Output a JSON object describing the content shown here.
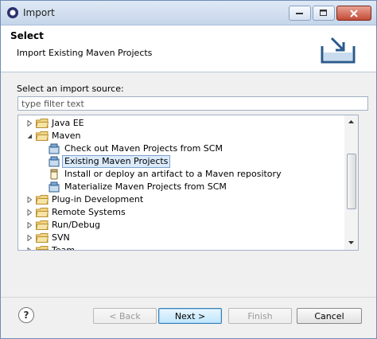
{
  "window": {
    "title": "Import"
  },
  "header": {
    "title": "Select",
    "subtitle": "Import Existing Maven Projects"
  },
  "source": {
    "label": "Select an import source:",
    "filter_placeholder": "type filter text"
  },
  "tree": {
    "rows": [
      {
        "label": "Java EE",
        "type": "folder",
        "level": 0,
        "expanded": false
      },
      {
        "label": "Maven",
        "type": "folder",
        "level": 0,
        "expanded": true
      },
      {
        "label": "Check out Maven Projects from SCM",
        "type": "wizard",
        "level": 1
      },
      {
        "label": "Existing Maven Projects",
        "type": "wizard",
        "level": 1,
        "selected": true
      },
      {
        "label": "Install or deploy an artifact to a Maven repository",
        "type": "jar",
        "level": 1
      },
      {
        "label": "Materialize Maven Projects from SCM",
        "type": "wizard",
        "level": 1
      },
      {
        "label": "Plug-in Development",
        "type": "folder",
        "level": 0,
        "expanded": false
      },
      {
        "label": "Remote Systems",
        "type": "folder",
        "level": 0,
        "expanded": false
      },
      {
        "label": "Run/Debug",
        "type": "folder",
        "level": 0,
        "expanded": false
      },
      {
        "label": "SVN",
        "type": "folder",
        "level": 0,
        "expanded": false
      },
      {
        "label": "Team",
        "type": "folder",
        "level": 0,
        "expanded": false
      }
    ]
  },
  "footer": {
    "help_icon": "question-mark-icon",
    "back_label": "< Back",
    "next_label": "Next >",
    "finish_label": "Finish",
    "cancel_label": "Cancel"
  },
  "colors": {
    "selection": "#dcebfc",
    "folder": "#e9c46a",
    "accent": "#3c7fb1"
  }
}
